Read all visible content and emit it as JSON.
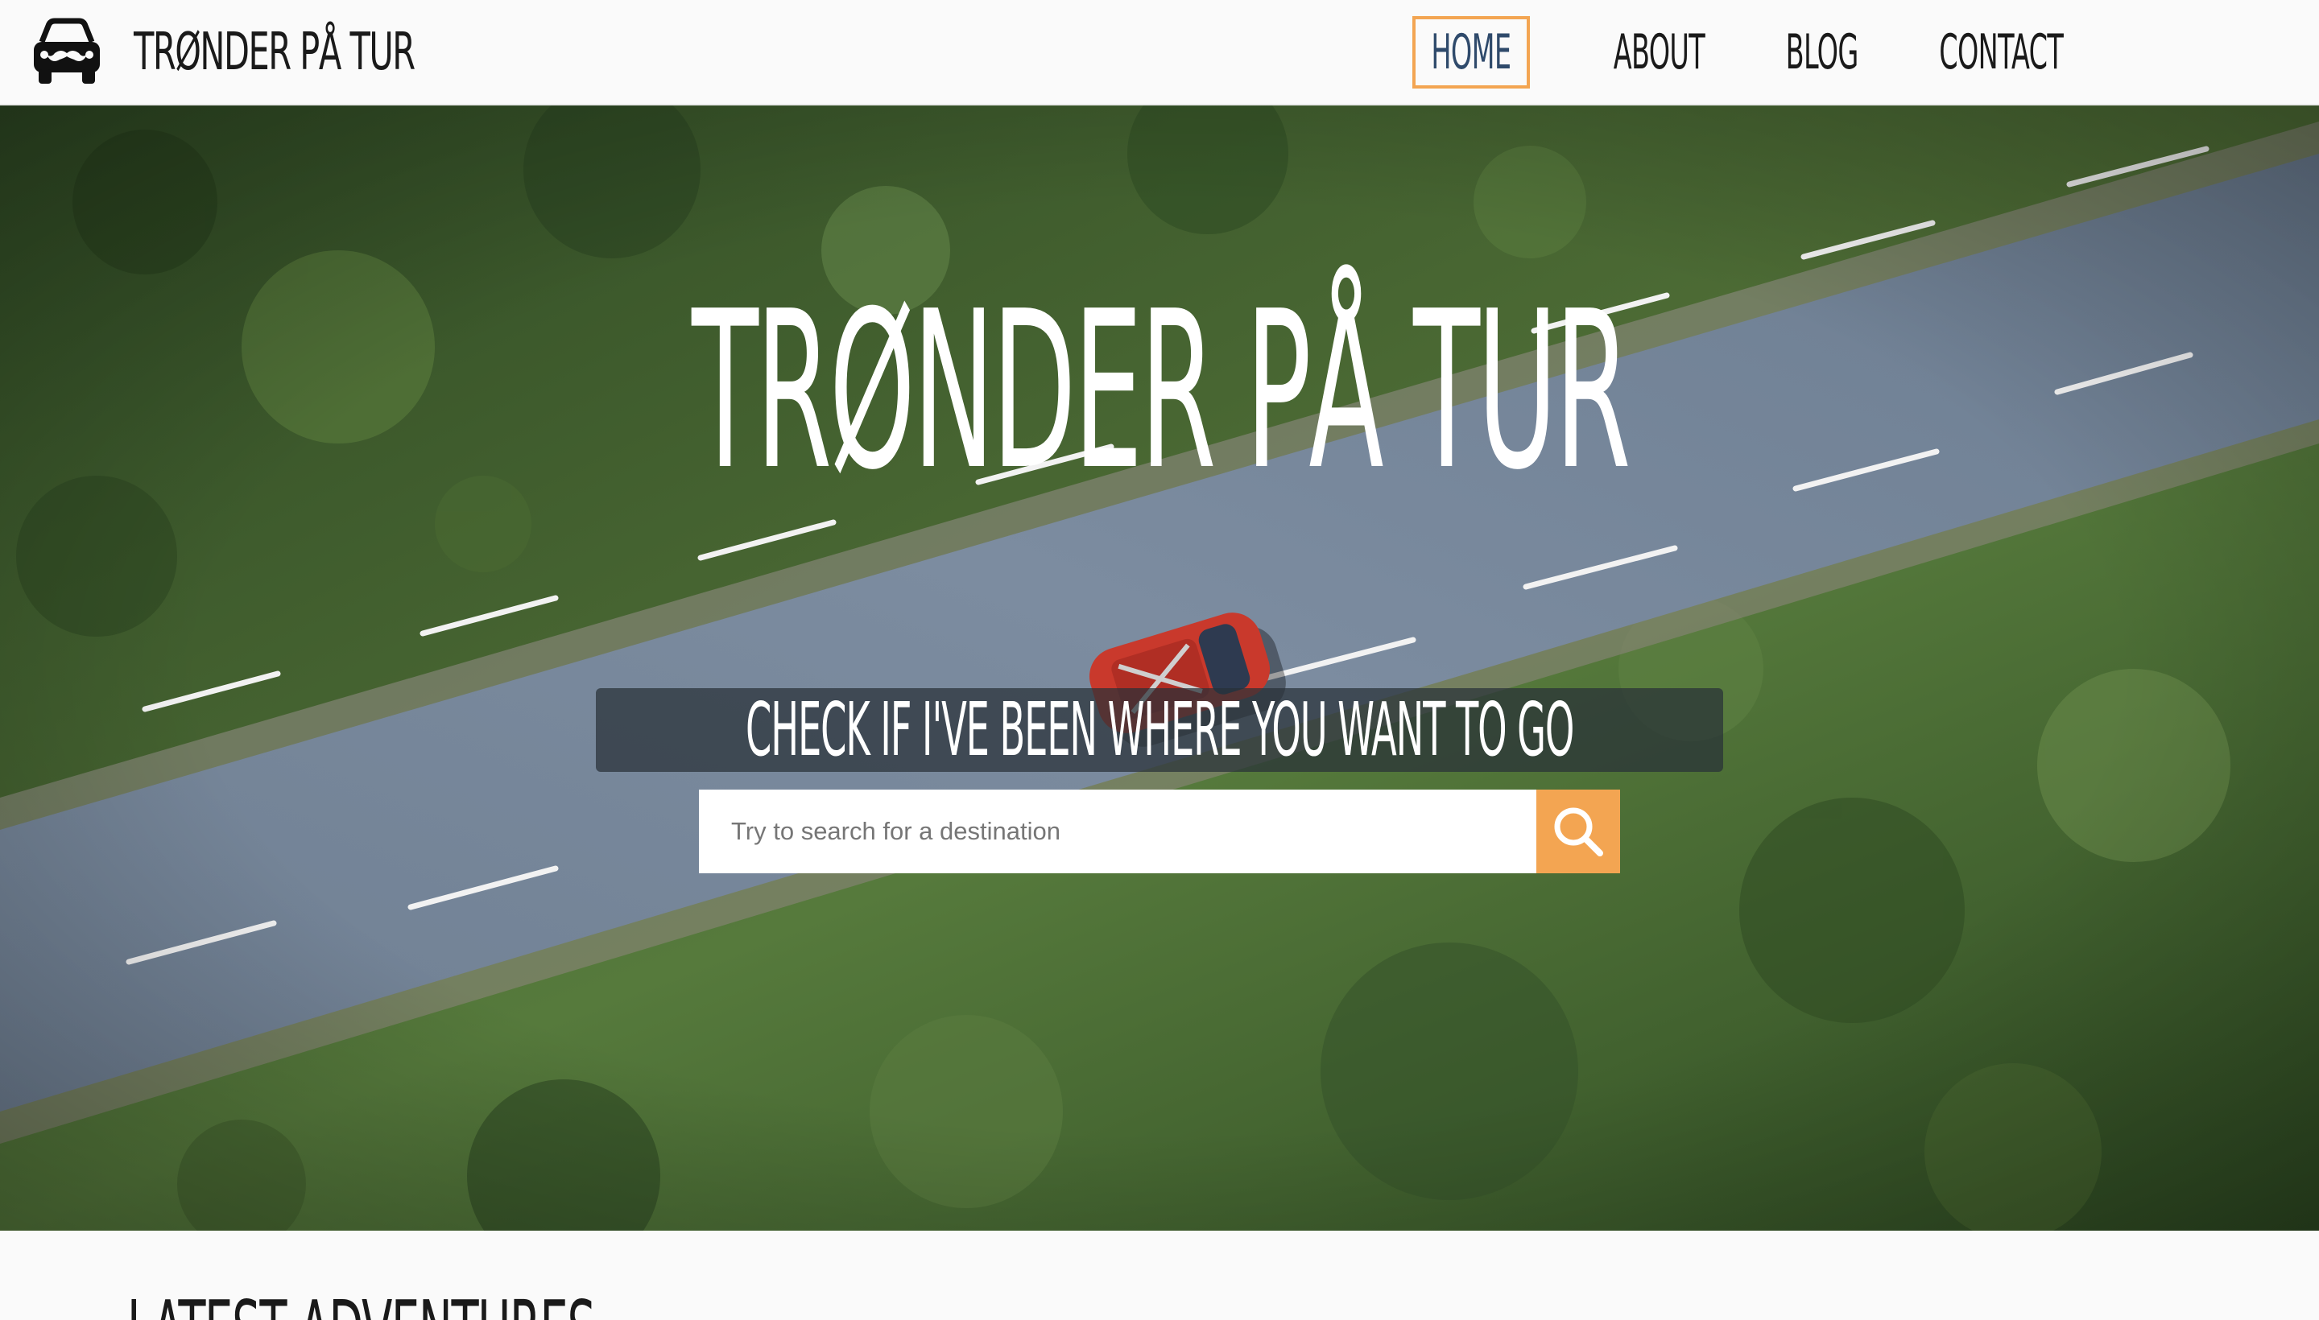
{
  "brand": {
    "name": "Trønder på tur",
    "logo_icon": "car-with-mustache-icon"
  },
  "nav": {
    "items": [
      {
        "label": "Home",
        "active": true
      },
      {
        "label": "About",
        "active": false
      },
      {
        "label": "Blog",
        "active": false
      },
      {
        "label": "Contact",
        "active": false
      }
    ]
  },
  "hero": {
    "title": "Trønder på tur",
    "tagline": "Check if I've been where you want to go",
    "search": {
      "placeholder": "Try to search for a destination",
      "value": "",
      "button_icon": "search-icon"
    }
  },
  "latest": {
    "title": "Latest adventures"
  },
  "colors": {
    "accent": "#f3a552",
    "active_nav_text": "#2f4a6b",
    "text": "#1a1a1a",
    "background": "#fafafa"
  }
}
